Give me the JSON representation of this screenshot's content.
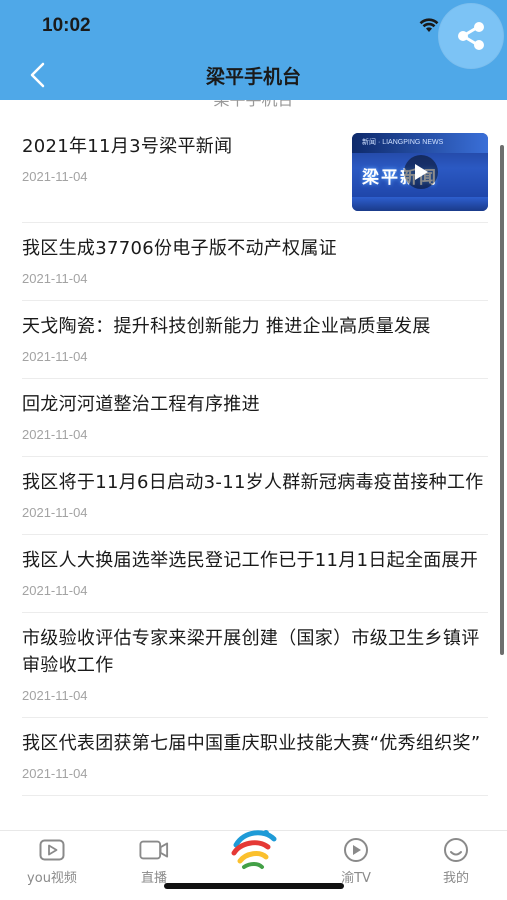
{
  "status_bar": {
    "time": "10:02"
  },
  "nav": {
    "title": "梁平手机台"
  },
  "partial_top_text": "梁平手机台",
  "news": [
    {
      "title": "2021年11月3号梁平新闻",
      "date": "2021-11-04",
      "has_thumbnail": true
    },
    {
      "title": "我区生成37706份电子版不动产权属证",
      "date": "2021-11-04"
    },
    {
      "title": "天戈陶瓷：提升科技创新能力 推进企业高质量发展",
      "date": "2021-11-04"
    },
    {
      "title": "回龙河河道整治工程有序推进",
      "date": "2021-11-04"
    },
    {
      "title": "我区将于11月6日启动3-11岁人群新冠病毒疫苗接种工作",
      "date": "2021-11-04"
    },
    {
      "title": "我区人大换届选举选民登记工作已于11月1日起全面展开",
      "date": "2021-11-04"
    },
    {
      "title": "市级验收评估专家来梁开展创建（国家）市级卫生乡镇评审验收工作",
      "date": "2021-11-04"
    },
    {
      "title": "我区代表团获第七届中国重庆职业技能大赛“优秀组织奖”",
      "date": "2021-11-04"
    }
  ],
  "thumbnail": {
    "banner_text": "新闻 · LIANGPING NEWS",
    "overlay_text": "梁平新闻"
  },
  "tabs": [
    {
      "label": "you视频",
      "icon": "video-play-icon"
    },
    {
      "label": "直播",
      "icon": "camera-icon"
    },
    {
      "label": "",
      "icon": "station-logo-icon"
    },
    {
      "label": "渝TV",
      "icon": "tv-play-icon"
    },
    {
      "label": "我的",
      "icon": "smile-icon"
    }
  ],
  "colors": {
    "header": "#4fa8e8",
    "share_button": "#7cc3f5",
    "date": "#a3a3a3",
    "tab_label": "#8a8a8a"
  }
}
